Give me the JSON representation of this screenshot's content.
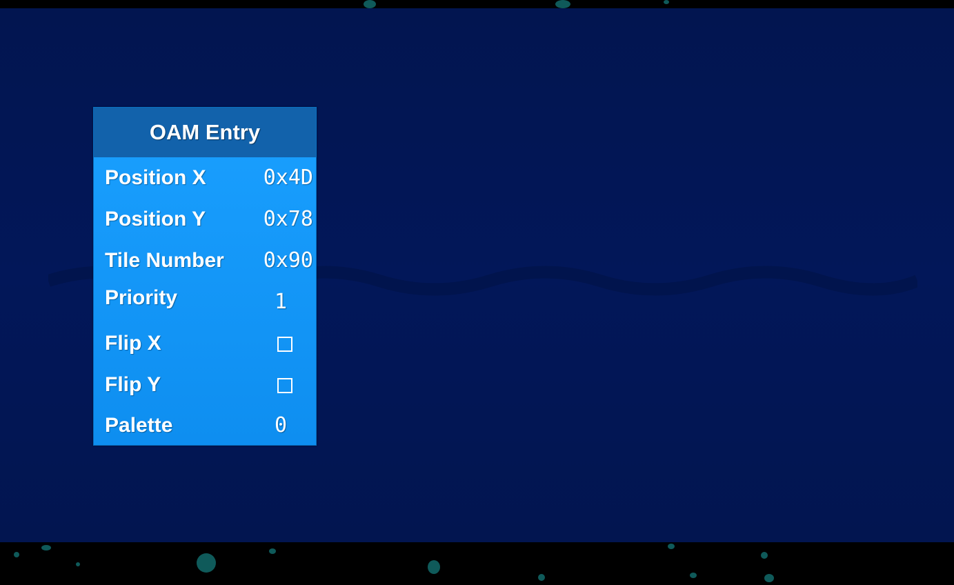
{
  "panel": {
    "title": "OAM Entry",
    "rows": [
      {
        "label": "Position X",
        "value": "0x4D"
      },
      {
        "label": "Position Y",
        "value": "0x78"
      },
      {
        "label": "Tile Number",
        "value": "0x90"
      },
      {
        "label": "Priority",
        "value": "1"
      },
      {
        "label": "Flip X",
        "checked": false
      },
      {
        "label": "Flip Y",
        "checked": false
      },
      {
        "label": "Palette",
        "value": "0"
      }
    ]
  },
  "colors": {
    "background": "#021759",
    "panel": "#1aa0ff",
    "header": "#1262ab",
    "text": "#ffffff"
  }
}
